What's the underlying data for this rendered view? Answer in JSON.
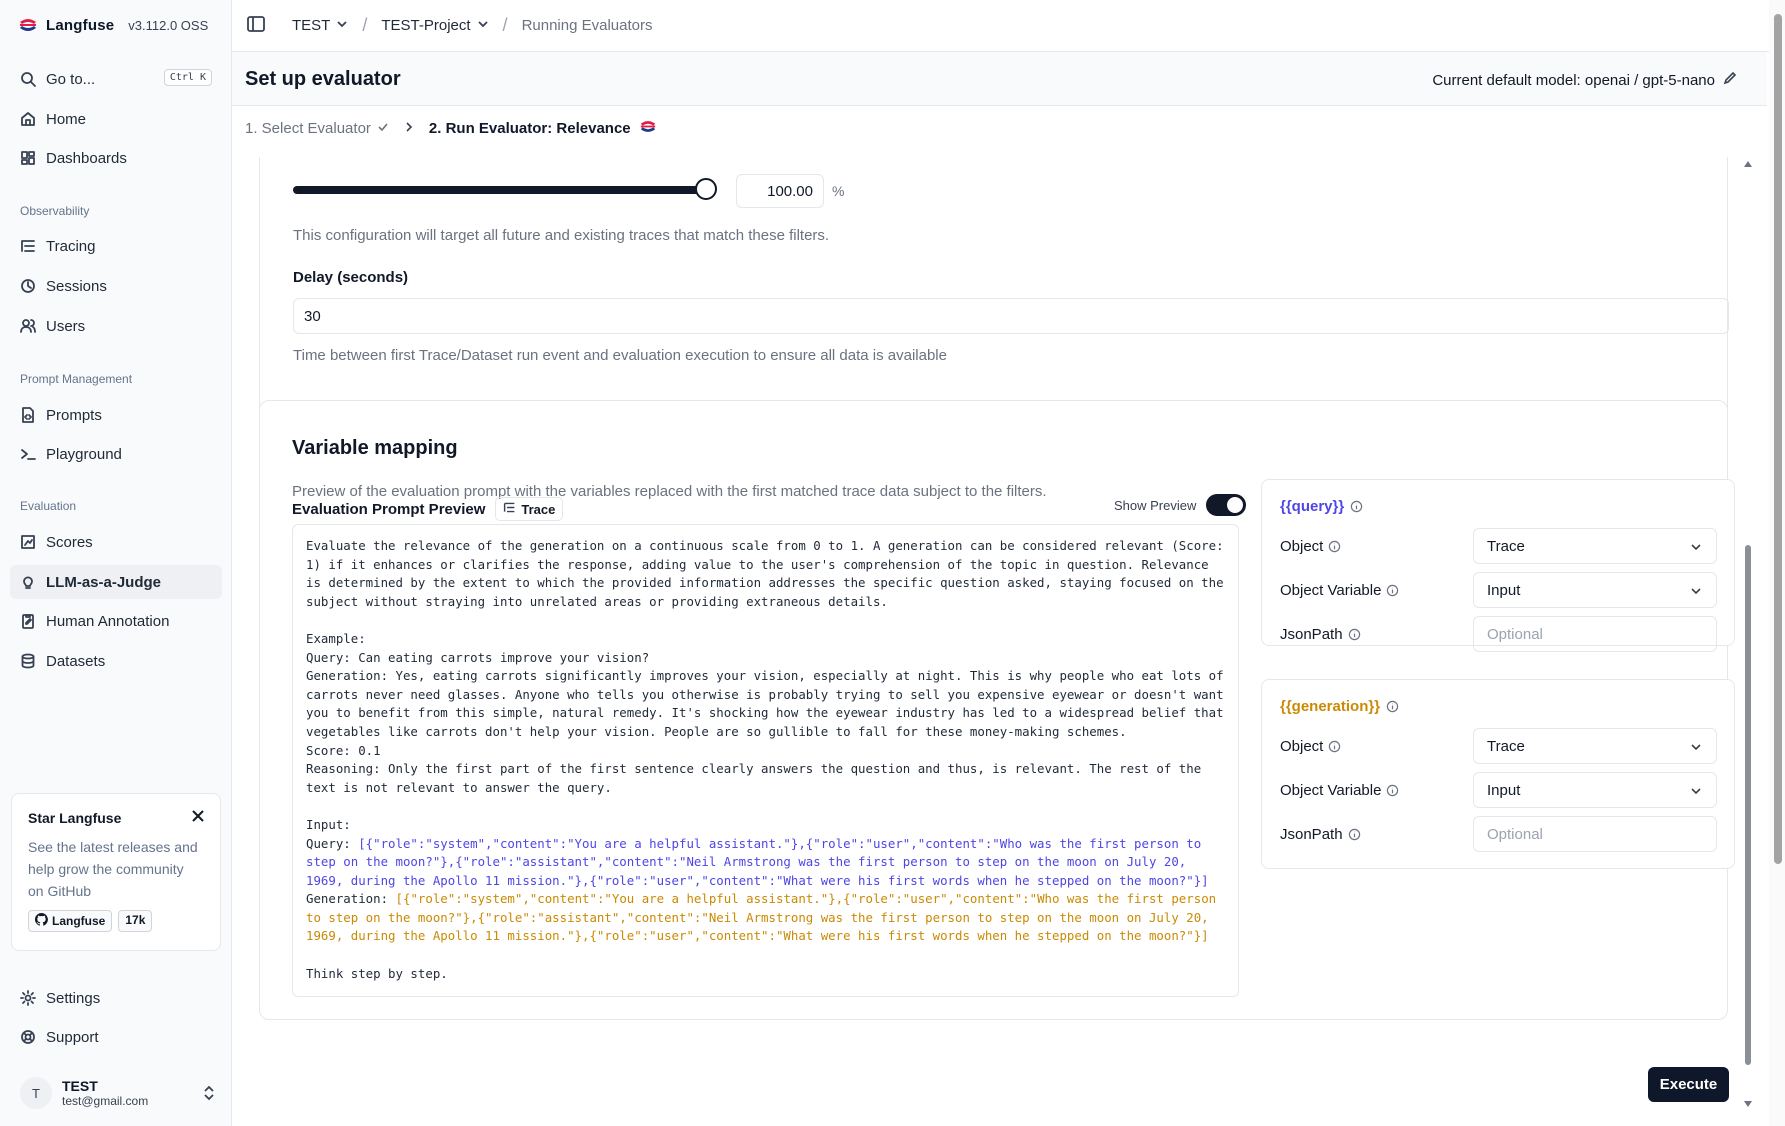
{
  "brand": {
    "name": "Langfuse",
    "version": "v3.112.0 OSS"
  },
  "sidebar": {
    "goto": {
      "label": "Go to...",
      "shortcut": "Ctrl K"
    },
    "home": "Home",
    "dashboards": "Dashboards",
    "sections": {
      "observability": "Observability",
      "prompt_management": "Prompt Management",
      "evaluation": "Evaluation"
    },
    "tracing": "Tracing",
    "sessions": "Sessions",
    "users": "Users",
    "prompts": "Prompts",
    "playground": "Playground",
    "scores": "Scores",
    "llm_judge": "LLM-as-a-Judge",
    "human_annotation": "Human Annotation",
    "datasets": "Datasets",
    "settings": "Settings",
    "support": "Support"
  },
  "star_card": {
    "title": "Star Langfuse",
    "text": "See the latest releases and help grow the community on GitHub",
    "gh_label": "Langfuse",
    "gh_count": "17k"
  },
  "user": {
    "initial": "T",
    "name": "TEST",
    "email": "test@gmail.com"
  },
  "topbar": {
    "org": "TEST",
    "project": "TEST-Project",
    "page": "Running Evaluators"
  },
  "header": {
    "title": "Set up evaluator",
    "default_model": "Current default model: openai / gpt-5-nano"
  },
  "steps": {
    "step1": "1. Select Evaluator",
    "step2": "2. Run Evaluator: Relevance"
  },
  "sampling": {
    "value": "100.00",
    "unit": "%",
    "fraction": 1.0,
    "note": "This configuration will target all future and existing traces that match these filters."
  },
  "delay": {
    "label": "Delay (seconds)",
    "value": "30",
    "help": "Time between first Trace/Dataset run event and evaluation execution to ensure all data is available"
  },
  "variable_mapping": {
    "title": "Variable mapping",
    "description": "Preview of the evaluation prompt with the variables replaced with the first matched trace data subject to the filters.",
    "preview_label": "Evaluation Prompt Preview",
    "trace_chip": "Trace",
    "show_preview": "Show Preview",
    "prompt_main": "Evaluate the relevance of the generation on a continuous scale from 0 to 1. A generation can be considered relevant (Score: 1) if it enhances or clarifies the response, adding value to the user's comprehension of the topic in question. Relevance is determined by the extent to which the provided information addresses the specific question asked, staying focused on the subject without straying into unrelated areas or providing extraneous details.\n\nExample:\nQuery: Can eating carrots improve your vision?\nGeneration: Yes, eating carrots significantly improves your vision, especially at night. This is why people who eat lots of carrots never need glasses. Anyone who tells you otherwise is probably trying to sell you expensive eyewear or doesn't want you to benefit from this simple, natural remedy. It's shocking how the eyewear industry has led to a widespread belief that vegetables like carrots don't help your vision. People are so gullible to fall for these money-making schemes.\nScore: 0.1\nReasoning: Only the first part of the first sentence clearly answers the question and thus, is relevant. The rest of the text is not relevant to answer the query.\n\nInput:\n",
    "query_prefix": "Query: ",
    "query_value": "[{\"role\":\"system\",\"content\":\"You are a helpful assistant.\"},{\"role\":\"user\",\"content\":\"Who was the first person to step on the moon?\"},{\"role\":\"assistant\",\"content\":\"Neil Armstrong was the first person to step on the moon on July 20, 1969, during the Apollo 11 mission.\"},{\"role\":\"user\",\"content\":\"What were his first words when he stepped on the moon?\"}]",
    "generation_prefix": "\nGeneration: ",
    "generation_value": "[{\"role\":\"system\",\"content\":\"You are a helpful assistant.\"},{\"role\":\"user\",\"content\":\"Who was the first person to step on the moon?\"},{\"role\":\"assistant\",\"content\":\"Neil Armstrong was the first person to step on the moon on July 20, 1969, during the Apollo 11 mission.\"},{\"role\":\"user\",\"content\":\"What were his first words when he stepped on the moon?\"}]",
    "prompt_end": "\n\nThink step by step.",
    "query_map": {
      "var": "{{query}}",
      "object_label": "Object",
      "object_value": "Trace",
      "variable_label": "Object Variable",
      "variable_value": "Input",
      "jsonpath_label": "JsonPath",
      "jsonpath_placeholder": "Optional"
    },
    "generation_map": {
      "var": "{{generation}}",
      "object_label": "Object",
      "object_value": "Trace",
      "variable_label": "Object Variable",
      "variable_value": "Input",
      "jsonpath_label": "JsonPath",
      "jsonpath_placeholder": "Optional"
    }
  },
  "execute_label": "Execute",
  "colors": {
    "query": "#4f46e5",
    "generation": "#ca8a04",
    "primary": "#0f172a"
  }
}
